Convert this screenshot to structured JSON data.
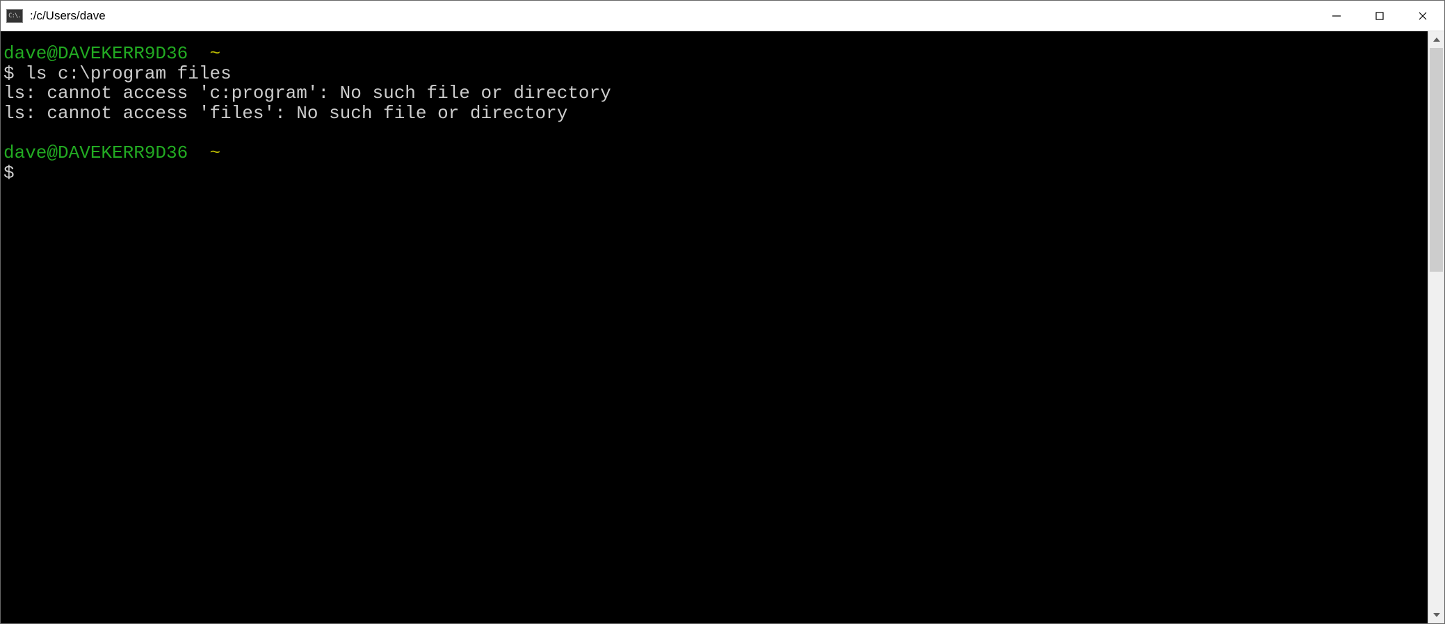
{
  "window": {
    "icon_label": "C:\\.",
    "title": ":/c/Users/dave"
  },
  "terminal": {
    "prompt1": {
      "user_host": "dave@DAVEKERR9D36",
      "path": "~",
      "symbol": "$ ",
      "command": "ls c:\\program files"
    },
    "output": {
      "line1": "ls: cannot access 'c:program': No such file or directory",
      "line2": "ls: cannot access 'files': No such file or directory"
    },
    "prompt2": {
      "user_host": "dave@DAVEKERR9D36",
      "path": "~",
      "symbol": "$"
    }
  }
}
